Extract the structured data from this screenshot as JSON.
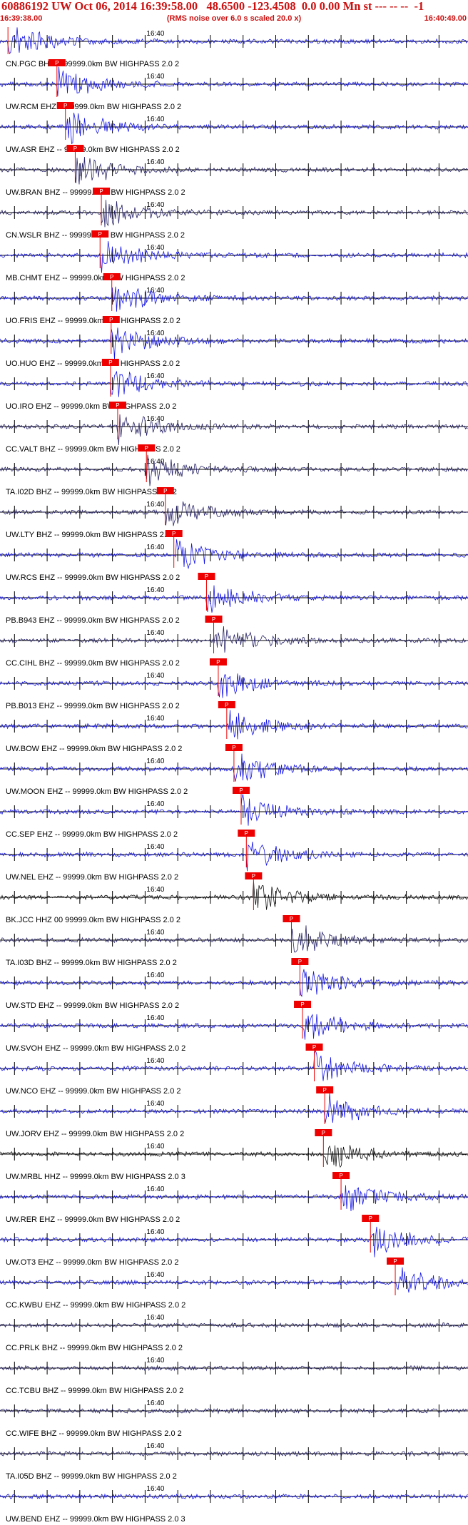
{
  "header": {
    "title": "60886192 UW Oct 06, 2014 16:39:58.00   48.6500 -123.4508  0.0 0.00 Mn st --- -- --  -1",
    "start_time": "16:39:38.00",
    "note": "(RMS noise over 6.0 s scaled 20.0 x)",
    "end_time": "16:40:49.00"
  },
  "chart_data": {
    "type": "line",
    "x_axis": {
      "start": "16:39:38.00",
      "end": "16:40:49.00",
      "tick_label": "16:40"
    },
    "pick_label": "P",
    "colors": {
      "blue": "#1414e6",
      "navy": "#262266",
      "black": "#111111",
      "pick": "#ee0000"
    },
    "traces": [
      {
        "label": "CN.PGC BHZ -- 99999.0km BW  HIGHPASS  2.0  2",
        "color": "blue",
        "pick_s": 1.0
      },
      {
        "label": "UW.RCM EHZ -- 99999.0km BW  HIGHPASS  2.0  2",
        "color": "blue",
        "pick_s": 8.5
      },
      {
        "label": "UW.ASR EHZ -- 99999.0km BW  HIGHPASS  2.0  2",
        "color": "blue",
        "pick_s": 9.8
      },
      {
        "label": "UW.BRAN BHZ -- 99999.0km BW  HIGHPASS  2.0  2",
        "color": "navy",
        "pick_s": 11.3
      },
      {
        "label": "CN.WSLR BHZ -- 99999.0km BW  HIGHPASS  2.0  2",
        "color": "navy",
        "pick_s": 15.3
      },
      {
        "label": "MB.CHMT EHZ -- 99999.0km BW  HIGHPASS  2.0  2",
        "color": "blue",
        "pick_s": 15.1
      },
      {
        "label": "UO.FRIS EHZ -- 99999.0km BW  HIGHPASS  2.0  2",
        "color": "blue",
        "pick_s": 16.9
      },
      {
        "label": "UO.HUO EHZ -- 99999.0km BW  HIGHPASS  2.0  2",
        "color": "blue",
        "pick_s": 16.8
      },
      {
        "label": "UO.IRO EHZ -- 99999.0km BW  HIGHPASS  2.0  2",
        "color": "blue",
        "pick_s": 16.7
      },
      {
        "label": "CC.VALT BHZ -- 99999.0km BW  HIGHPASS  2.0  2",
        "color": "navy",
        "pick_s": 17.8
      },
      {
        "label": "TA.I02D BHZ -- 99999.0km BW  HIGHPASS  2.0  2",
        "color": "navy",
        "pick_s": 22.2
      },
      {
        "label": "UW.LTY BHZ -- 99999.0km BW  HIGHPASS  2.0  2",
        "color": "navy",
        "pick_s": 25.1
      },
      {
        "label": "UW.RCS EHZ -- 99999.0km BW  HIGHPASS  2.0  2",
        "color": "blue",
        "pick_s": 26.4
      },
      {
        "label": "PB.B943 EHZ -- 99999.0km BW  HIGHPASS  2.0  2",
        "color": "blue",
        "pick_s": 31.4
      },
      {
        "label": "CC.CIHL BHZ -- 99999.0km BW  HIGHPASS  2.0  2",
        "color": "navy",
        "pick_s": 32.5
      },
      {
        "label": "PB.B013 EHZ -- 99999.0km BW  HIGHPASS  2.0  2",
        "color": "blue",
        "pick_s": 33.2
      },
      {
        "label": "UW.BOW EHZ -- 99999.0km BW  HIGHPASS  2.0  2",
        "color": "blue",
        "pick_s": 34.5
      },
      {
        "label": "UW.MOON EHZ -- 99999.0km BW  HIGHPASS  2.0  2",
        "color": "blue",
        "pick_s": 35.6
      },
      {
        "label": "CC.SEP EHZ -- 99999.0km BW  HIGHPASS  2.0  2",
        "color": "blue",
        "pick_s": 36.7
      },
      {
        "label": "UW.NEL EHZ -- 99999.0km BW  HIGHPASS  2.0  2",
        "color": "blue",
        "pick_s": 37.5
      },
      {
        "label": "BK.JCC HHZ 00 99999.0km BW  HIGHPASS  2.0  2",
        "color": "black",
        "pick_s": 38.6
      },
      {
        "label": "TA.I03D BHZ -- 99999.0km BW  HIGHPASS  2.0  2",
        "color": "navy",
        "pick_s": 44.4
      },
      {
        "label": "UW.STD EHZ -- 99999.0km BW  HIGHPASS  2.0  2",
        "color": "blue",
        "pick_s": 45.7
      },
      {
        "label": "UW.SVOH EHZ -- 99999.0km BW  HIGHPASS  2.0  2",
        "color": "blue",
        "pick_s": 46.1
      },
      {
        "label": "UW.NCO EHZ -- 99999.0km BW  HIGHPASS  2.0  2",
        "color": "blue",
        "pick_s": 47.9
      },
      {
        "label": "UW.JORV EHZ -- 99999.0km BW  HIGHPASS  2.0  2",
        "color": "blue",
        "pick_s": 49.5
      },
      {
        "label": "UW.MRBL HHZ -- 99999.0km BW  HIGHPASS  2.0  3",
        "color": "black",
        "pick_s": 49.3
      },
      {
        "label": "UW.RER EHZ -- 99999.0km BW  HIGHPASS  2.0  2",
        "color": "blue",
        "pick_s": 52.0
      },
      {
        "label": "UW.OT3 EHZ -- 99999.0km BW  HIGHPASS  2.0  2",
        "color": "blue",
        "pick_s": 56.5
      },
      {
        "label": "CC.KWBU EHZ -- 99999.0km BW  HIGHPASS  2.0  2",
        "color": "blue",
        "pick_s": 60.3
      },
      {
        "label": "CC.PRLK BHZ -- 99999.0km BW  HIGHPASS  2.0  2",
        "color": "navy",
        "pick_s": null
      },
      {
        "label": "CC.TCBU BHZ -- 99999.0km BW  HIGHPASS  2.0  2",
        "color": "navy",
        "pick_s": null
      },
      {
        "label": "CC.WIFE BHZ -- 99999.0km BW  HIGHPASS  2.0  2",
        "color": "navy",
        "pick_s": null
      },
      {
        "label": "TA.I05D BHZ -- 99999.0km BW  HIGHPASS  2.0  2",
        "color": "navy",
        "pick_s": null
      },
      {
        "label": "UW.BEND EHZ -- 99999.0km BW  HIGHPASS  2.0  3",
        "color": "blue",
        "pick_s": null
      }
    ]
  }
}
